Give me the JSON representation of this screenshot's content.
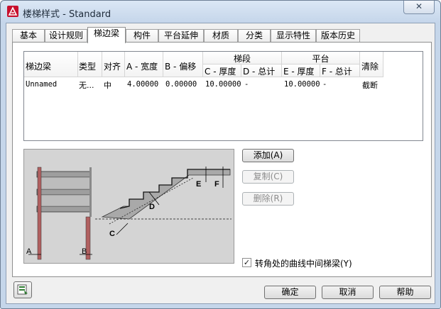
{
  "window": {
    "title": "楼梯样式 - Standard",
    "close_label": "✕"
  },
  "tabs": [
    {
      "label": "基本"
    },
    {
      "label": "设计规则"
    },
    {
      "label": "梯边梁",
      "active": true
    },
    {
      "label": "构件"
    },
    {
      "label": "平台延伸"
    },
    {
      "label": "材质"
    },
    {
      "label": "分类"
    },
    {
      "label": "显示特性"
    },
    {
      "label": "版本历史"
    }
  ],
  "table": {
    "headers": {
      "stringer": "梯边梁",
      "type": "类型",
      "align": "对齐",
      "a_width": "A - 宽度",
      "b_offset": "B - 偏移",
      "stair_group": "梯段",
      "c_thickness": "C - 厚度",
      "d_total": "D - 总计",
      "landing_group": "平台",
      "e_thickness": "E - 厚度",
      "f_total": "F - 总计",
      "clean": "清除"
    },
    "rows": [
      {
        "stringer": "Unnamed",
        "type": "无...",
        "align": "中",
        "a_width": "4.00000",
        "b_offset": "0.00000",
        "c_thickness": "10.00000",
        "d_total": "-",
        "e_thickness": "10.00000",
        "f_total": "-",
        "clean": "截断"
      }
    ]
  },
  "preview": {
    "labels": {
      "a": "A",
      "b": "B",
      "c": "C",
      "d": "D",
      "e": "E",
      "f": "F"
    }
  },
  "buttons": {
    "add": "添加(A)",
    "copy": "复制(C)",
    "delete": "删除(R)"
  },
  "checkbox": {
    "label": "转角处的曲线中间梯梁(Y)",
    "checked": true,
    "mark": "✓"
  },
  "footer": {
    "ok": "确定",
    "cancel": "取消",
    "help": "帮助"
  },
  "colors": {
    "accent": "#c8102e",
    "titlebar": "#c4d5ea"
  }
}
